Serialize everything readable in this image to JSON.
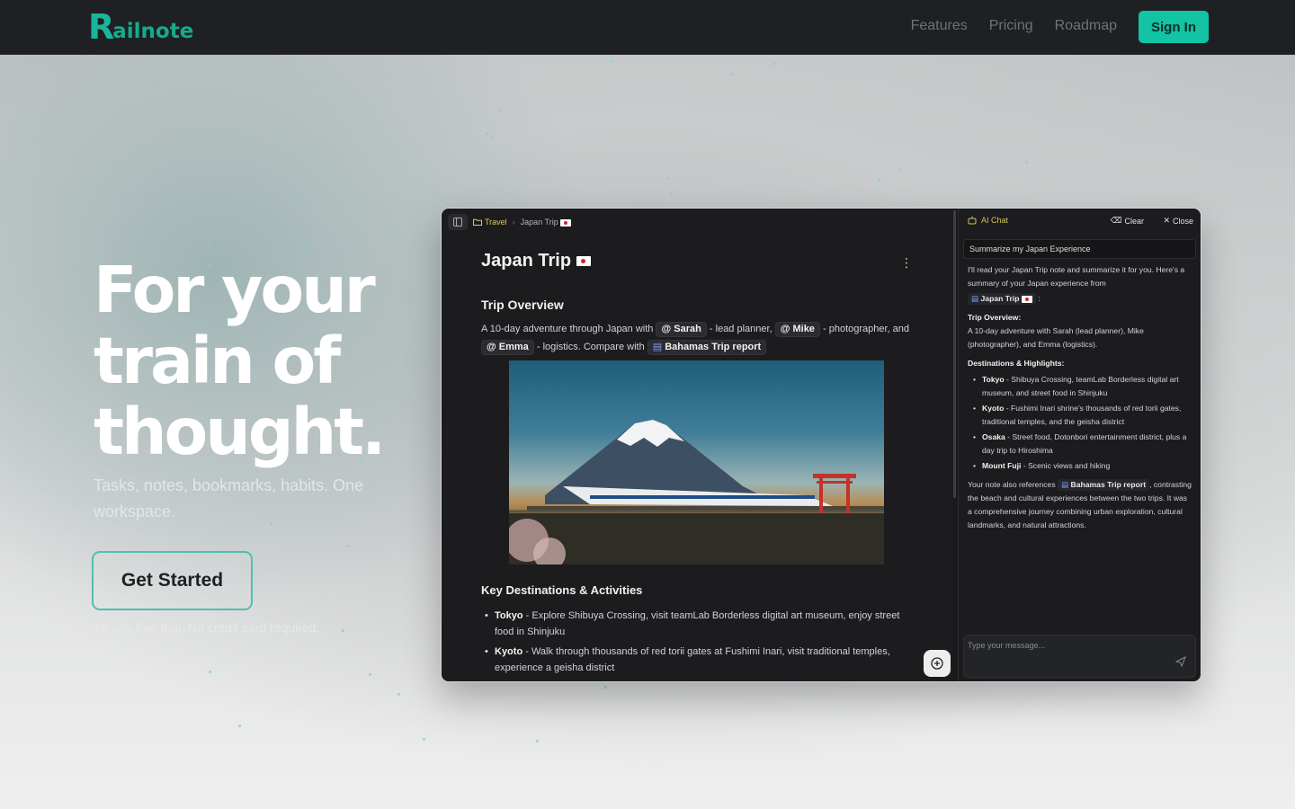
{
  "nav": {
    "logo_r": "R",
    "logo_rest": "ailnote",
    "links": [
      "Features",
      "Pricing",
      "Roadmap"
    ],
    "signin_label": "Sign In"
  },
  "hero": {
    "headline_lines": [
      "For your",
      "train of",
      "thought."
    ],
    "subline": "Tasks, notes, bookmarks, habits. One workspace.",
    "cta_label": "Get Started",
    "trial_note": "14-day free trial. No credit card required."
  },
  "app": {
    "breadcrumb": {
      "parent": "Travel",
      "current": "Japan Trip"
    },
    "note": {
      "title": "Japan Trip",
      "overview_heading": "Trip Overview",
      "overview": {
        "intro": "A 10-day adventure through Japan with",
        "mention1": "@ Sarah",
        "role1": "- lead planner,",
        "mention2": "@ Mike",
        "role2": "- photographer, and",
        "mention3": "@ Emma",
        "role3": "- logistics. Compare with",
        "doc_ref": "Bahamas Trip report"
      },
      "destinations_heading": "Key Destinations & Activities",
      "destinations": [
        {
          "name": "Tokyo",
          "text": " - Explore Shibuya Crossing, visit teamLab Borderless digital art museum, enjoy street food in Shinjuku"
        },
        {
          "name": "Kyoto",
          "text": " - Walk through thousands of red torii gates at Fushimi Inari, visit traditional temples, experience a geisha district"
        }
      ]
    },
    "chat": {
      "title": "AI Chat",
      "clear_label": "Clear",
      "close_label": "Close",
      "prompt": "Summarize my Japan Experience",
      "reply_intro": "I'll read your Japan Trip note and summarize it for you. Here's a summary of your Japan experience from",
      "ref_note": "Japan Trip",
      "overview_label": "Trip Overview:",
      "overview_text": "A 10-day adventure with Sarah (lead planner), Mike (photographer), and Emma (logistics).",
      "highlights_label": "Destinations & Highlights:",
      "highlights": [
        {
          "name": "Tokyo",
          "text": " - Shibuya Crossing, teamLab Borderless digital art museum, and street food in Shinjuku"
        },
        {
          "name": "Kyoto",
          "text": " - Fushimi Inari shrine's thousands of red torii gates, traditional temples, and the geisha district"
        },
        {
          "name": "Osaka",
          "text": " - Street food, Dotonbori entertainment district, plus a day trip to Hiroshima"
        },
        {
          "name": "Mount Fuji",
          "text": " - Scenic views and hiking"
        }
      ],
      "outro_prefix": "Your note also references",
      "outro_ref": "Bahamas Trip report",
      "outro_text": ", contrasting the beach and cultural experiences between the two trips. It was a comprehensive journey combining urban exploration, cultural landmarks, and natural attractions.",
      "input_placeholder": "Type your message..."
    }
  },
  "colors": {
    "accent": "#12c3a4",
    "nav_bg": "#1f2023",
    "app_bg": "#1c1c1e",
    "folder_yellow": "#e3c85b"
  },
  "icons": [
    "sidebar-toggle-icon",
    "folder-icon",
    "chevron-right-icon",
    "japan-flag-icon",
    "kebab-menu-icon",
    "document-icon",
    "sparkle-bot-icon",
    "eraser-icon",
    "close-icon",
    "plus-circle-icon",
    "send-icon"
  ]
}
